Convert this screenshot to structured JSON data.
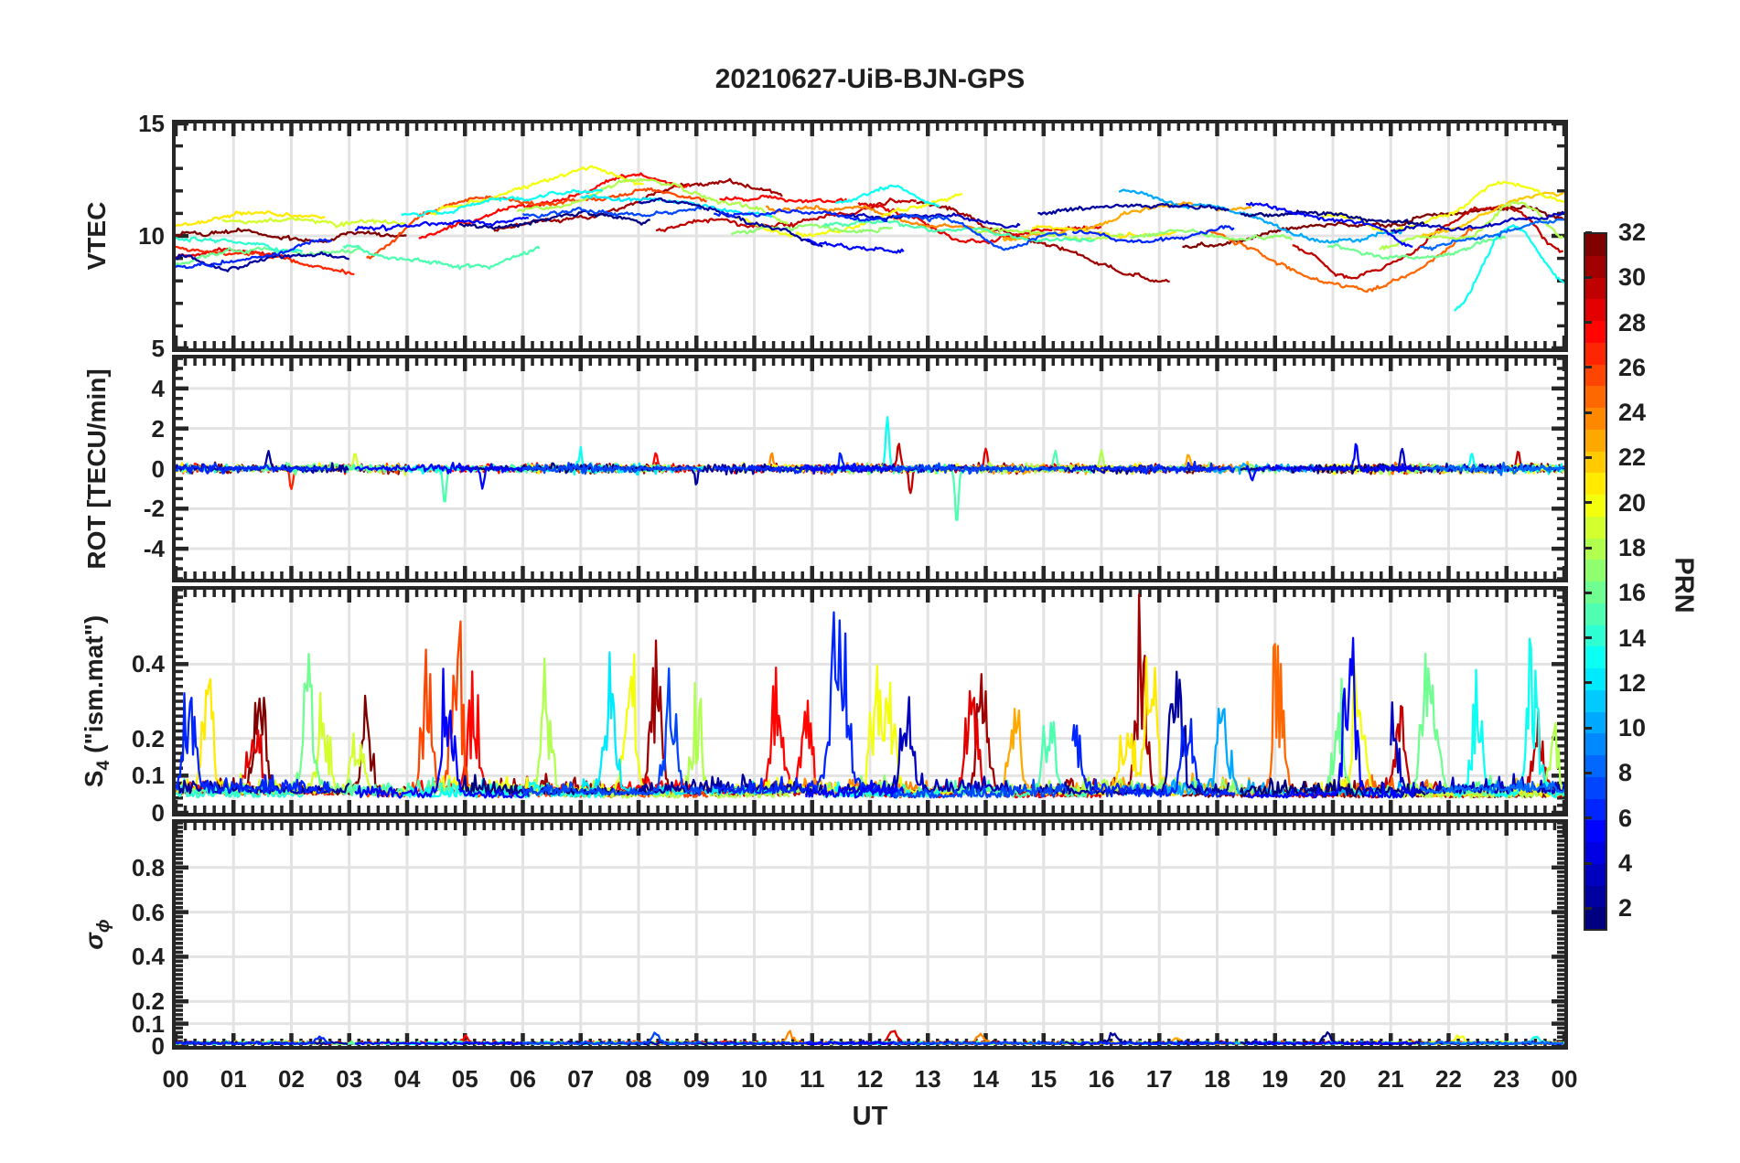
{
  "title": "20210627-UiB-BJN-GPS",
  "xlabel": "UT",
  "colorbar": {
    "label": "PRN",
    "min": 1,
    "max": 32,
    "ticks": [
      2,
      4,
      6,
      8,
      10,
      12,
      14,
      16,
      18,
      20,
      22,
      24,
      26,
      28,
      30,
      32
    ]
  },
  "style": {
    "axis": "#262626",
    "grid": "#e3e3e3",
    "text": "#1f1f1f",
    "bg": "#ffffff"
  },
  "chart_data": {
    "type": "line",
    "x": {
      "unit": "hours UT",
      "range": [
        0,
        24
      ],
      "tick_step": 1,
      "tick_labels": [
        "00",
        "01",
        "02",
        "03",
        "04",
        "05",
        "06",
        "07",
        "08",
        "09",
        "10",
        "11",
        "12",
        "13",
        "14",
        "15",
        "16",
        "17",
        "18",
        "19",
        "20",
        "21",
        "22",
        "23",
        "00"
      ]
    },
    "seed": 1234,
    "series_format": "[prn, t_start_h, t_end_h, [control values sampled evenly in time]]",
    "spike_format": "[t_hour, prn, peak_value]",
    "panels": [
      {
        "id": "vtec",
        "ylabel": "VTEC",
        "ylim": [
          5,
          15
        ],
        "yticks": [
          5,
          10,
          15
        ],
        "minor_step": 1,
        "series": [
          [
            32,
            0.0,
            4.0,
            [
              10.2,
              10.25,
              9.9,
              10.05,
              9.8
            ]
          ],
          [
            31,
            5.5,
            10.5,
            [
              10.3,
              10.7,
              11.15,
              12.0,
              12.55,
              11.8
            ]
          ],
          [
            30,
            8.3,
            12.8,
            [
              10.25,
              10.55,
              10.4,
              11.0,
              11.75
            ]
          ],
          [
            31,
            12.8,
            17.2,
            [
              11.5,
              10.9,
              10.25,
              9.35,
              8.55,
              7.9
            ]
          ],
          [
            32,
            17.4,
            24.0,
            [
              9.4,
              9.9,
              10.2,
              10.6,
              10.5,
              11.0,
              11.35,
              10.65
            ]
          ],
          [
            29,
            0.0,
            1.9,
            [
              9.0,
              9.35,
              9.2
            ]
          ],
          [
            28,
            4.2,
            8.9,
            [
              10.0,
              10.75,
              11.3,
              11.9,
              12.65,
              12.2
            ]
          ],
          [
            28,
            9.4,
            11.6,
            [
              11.6,
              11.5,
              11.45
            ]
          ],
          [
            29,
            11.8,
            16.0,
            [
              11.35,
              10.8,
              9.6,
              10.35,
              10.2
            ]
          ],
          [
            30,
            19.3,
            24.0,
            [
              9.6,
              8.0,
              9.0,
              10.6,
              11.3,
              9.4
            ]
          ],
          [
            27,
            0.0,
            3.1,
            [
              9.6,
              9.2,
              8.9,
              8.3
            ]
          ],
          [
            26,
            3.3,
            9.2,
            [
              9.1,
              10.8,
              11.9,
              11.3,
              11.8,
              12.0,
              11.5
            ]
          ],
          [
            25,
            17.8,
            22.5,
            [
              10.1,
              9.3,
              8.25,
              7.6,
              8.8,
              10.3
            ]
          ],
          [
            24,
            10.2,
            14.5,
            [
              11.3,
              11.2,
              10.85,
              10.4,
              10.0
            ]
          ],
          [
            23,
            14.3,
            18.6,
            [
              9.8,
              10.3,
              10.95,
              11.4,
              11.25
            ]
          ],
          [
            22,
            21.5,
            24.0,
            [
              9.9,
              10.7,
              11.6,
              11.8
            ]
          ],
          [
            21,
            0.0,
            2.6,
            [
              10.4,
              11.15,
              10.7
            ]
          ],
          [
            20,
            4.4,
            8.1,
            [
              10.9,
              11.6,
              12.3,
              12.85,
              12.4
            ]
          ],
          [
            20,
            9.7,
            13.6,
            [
              10.8,
              10.1,
              10.4,
              11.2,
              11.7
            ]
          ],
          [
            21,
            14.8,
            17.3,
            [
              10.4,
              10.05,
              10.3
            ]
          ],
          [
            20,
            19.8,
            24.0,
            [
              10.9,
              10.4,
              11.0,
              12.3,
              11.7
            ]
          ],
          [
            19,
            0.8,
            4.0,
            [
              10.6,
              11.0,
              10.4,
              10.7
            ]
          ],
          [
            18,
            5.9,
            10.6,
            [
              11.0,
              11.6,
              12.2,
              12.3,
              11.4,
              10.4
            ]
          ],
          [
            17,
            9.6,
            12.4,
            [
              10.2,
              10.5,
              10.15
            ]
          ],
          [
            18,
            13.8,
            16.4,
            [
              10.2,
              9.95,
              10.1
            ]
          ],
          [
            17,
            16.5,
            19.3,
            [
              10.0,
              9.9,
              9.8
            ]
          ],
          [
            18,
            20.8,
            24.0,
            [
              9.4,
              9.8,
              10.1,
              11.4,
              9.8
            ]
          ],
          [
            16,
            0.0,
            3.2,
            [
              8.6,
              9.4,
              9.0,
              9.3
            ]
          ],
          [
            15,
            2.9,
            6.3,
            [
              9.4,
              9.0,
              8.45,
              9.7
            ]
          ],
          [
            15,
            11.2,
            15.9,
            [
              10.4,
              10.6,
              10.3,
              9.9,
              9.8
            ]
          ],
          [
            16,
            19.9,
            23.0,
            [
              9.4,
              9.15,
              9.0,
              9.9
            ]
          ],
          [
            14,
            0.0,
            2.2,
            [
              9.9,
              9.7,
              9.5
            ]
          ],
          [
            13,
            3.9,
            7.4,
            [
              10.9,
              11.4,
              11.7,
              12.1
            ]
          ],
          [
            12,
            7.0,
            10.3,
            [
              11.8,
              11.5,
              11.2,
              10.9
            ]
          ],
          [
            13,
            11.4,
            13.2,
            [
              11.5,
              12.0,
              11.3
            ]
          ],
          [
            10,
            16.3,
            21.2,
            [
              11.9,
              11.6,
              11.0,
              10.2,
              9.7,
              10.3
            ]
          ],
          [
            13,
            22.1,
            24.0,
            [
              6.7,
              10.3,
              8.0
            ]
          ],
          [
            2,
            0.0,
            3.0,
            [
              9.0,
              8.8,
              9.1,
              9.0
            ]
          ],
          [
            1,
            4.9,
            8.2,
            [
              10.4,
              10.6,
              10.9,
              10.7
            ]
          ],
          [
            2,
            8.0,
            11.2,
            [
              11.6,
              11.3,
              10.6,
              9.5
            ]
          ],
          [
            3,
            11.5,
            14.6,
            [
              10.9,
              10.7,
              10.9,
              10.6
            ]
          ],
          [
            2,
            14.9,
            18.2,
            [
              10.9,
              11.3,
              11.4,
              11.2
            ]
          ],
          [
            1,
            18.4,
            21.6,
            [
              10.9,
              11.0,
              10.8,
              10.5
            ]
          ],
          [
            3,
            21.0,
            24.0,
            [
              10.3,
              10.4,
              10.8,
              10.9
            ]
          ],
          [
            6,
            0.0,
            2.7,
            [
              8.6,
              9.0,
              9.6
            ]
          ],
          [
            5,
            3.1,
            6.1,
            [
              10.3,
              10.5,
              10.4,
              10.6
            ]
          ],
          [
            7,
            6.0,
            9.1,
            [
              10.9,
              11.2,
              10.9,
              11.1
            ]
          ],
          [
            6,
            9.3,
            12.3,
            [
              10.9,
              11.0,
              10.8,
              10.7
            ]
          ],
          [
            5,
            10.9,
            12.6,
            [
              9.9,
              9.4,
              9.5
            ]
          ],
          [
            7,
            12.4,
            15.4,
            [
              10.9,
              10.5,
              9.6,
              9.9
            ]
          ],
          [
            6,
            15.5,
            18.3,
            [
              10.1,
              9.9,
              10.2
            ]
          ],
          [
            5,
            18.5,
            21.4,
            [
              11.3,
              11.1,
              10.6,
              9.7
            ]
          ],
          [
            8,
            21.5,
            24.0,
            [
              9.5,
              9.9,
              10.3,
              10.6
            ]
          ]
        ]
      },
      {
        "id": "rot",
        "ylabel": "ROT [TECU/min]",
        "ylim": [
          -5.5,
          5.5
        ],
        "yticks": [
          -4,
          -2,
          0,
          2,
          4
        ],
        "minor_step": 0.5,
        "baseline": 0,
        "noise_amp": 0.14,
        "spikes": [
          [
            1.6,
            2,
            0.9
          ],
          [
            2.0,
            26,
            -1.0
          ],
          [
            3.1,
            21,
            0.8
          ],
          [
            4.65,
            15,
            -1.7
          ],
          [
            5.3,
            5,
            -0.9
          ],
          [
            7.0,
            13,
            0.9
          ],
          [
            8.3,
            28,
            0.8
          ],
          [
            9.0,
            2,
            -0.8
          ],
          [
            10.3,
            24,
            0.7
          ],
          [
            11.5,
            7,
            0.8
          ],
          [
            12.3,
            13,
            2.5
          ],
          [
            12.5,
            31,
            1.3
          ],
          [
            12.7,
            31,
            -1.3
          ],
          [
            13.5,
            15,
            -2.7
          ],
          [
            14.0,
            29,
            1.0
          ],
          [
            15.2,
            15,
            0.8
          ],
          [
            16.0,
            16,
            0.9
          ],
          [
            17.5,
            24,
            0.8
          ],
          [
            18.6,
            5,
            -0.7
          ],
          [
            20.4,
            5,
            1.2
          ],
          [
            21.2,
            3,
            1.0
          ],
          [
            22.4,
            14,
            0.8
          ],
          [
            23.2,
            29,
            0.9
          ]
        ]
      },
      {
        "id": "s4",
        "ylabel": "S4 (\"ism.mat\")",
        "ylabel_parts": {
          "pre": "S",
          "sub": "4",
          "post": " (\"ism.mat\")",
          "italic": false
        },
        "ylim": [
          0,
          0.6
        ],
        "yticks": [
          0,
          0.1,
          0.2,
          0.4
        ],
        "minor_step": 0.02,
        "baseline": 0.05,
        "spikes": [
          [
            0.25,
            6,
            0.37
          ],
          [
            0.55,
            22,
            0.33
          ],
          [
            1.35,
            29,
            0.3
          ],
          [
            1.45,
            32,
            0.38
          ],
          [
            2.3,
            15,
            0.4
          ],
          [
            2.55,
            18,
            0.28
          ],
          [
            3.15,
            21,
            0.25
          ],
          [
            3.3,
            32,
            0.27
          ],
          [
            4.35,
            26,
            0.38
          ],
          [
            4.7,
            6,
            0.37
          ],
          [
            4.85,
            26,
            0.5
          ],
          [
            5.15,
            28,
            0.3
          ],
          [
            6.4,
            16,
            0.32
          ],
          [
            7.5,
            13,
            0.37
          ],
          [
            7.85,
            20,
            0.55
          ],
          [
            8.3,
            31,
            0.42
          ],
          [
            8.55,
            6,
            0.4
          ],
          [
            9.0,
            18,
            0.25
          ],
          [
            10.4,
            28,
            0.43
          ],
          [
            10.9,
            26,
            0.36
          ],
          [
            11.35,
            7,
            0.38
          ],
          [
            11.55,
            9,
            0.45
          ],
          [
            12.1,
            20,
            0.36
          ],
          [
            12.35,
            19,
            0.33
          ],
          [
            12.65,
            5,
            0.3
          ],
          [
            13.75,
            29,
            0.45
          ],
          [
            13.95,
            31,
            0.38
          ],
          [
            14.5,
            23,
            0.28
          ],
          [
            15.1,
            15,
            0.3
          ],
          [
            15.55,
            10,
            0.28
          ],
          [
            16.45,
            20,
            0.3
          ],
          [
            16.7,
            32,
            0.47
          ],
          [
            16.85,
            20,
            0.45
          ],
          [
            17.3,
            2,
            0.44
          ],
          [
            17.5,
            5,
            0.35
          ],
          [
            18.1,
            8,
            0.3
          ],
          [
            19.05,
            26,
            0.38
          ],
          [
            20.1,
            17,
            0.31
          ],
          [
            20.3,
            6,
            0.53
          ],
          [
            20.45,
            20,
            0.4
          ],
          [
            21.0,
            3,
            0.33
          ],
          [
            21.15,
            29,
            0.28
          ],
          [
            21.6,
            12,
            0.28
          ],
          [
            21.75,
            15,
            0.3
          ],
          [
            22.5,
            14,
            0.33
          ],
          [
            23.45,
            15,
            0.42
          ],
          [
            23.55,
            29,
            0.26
          ],
          [
            23.8,
            18,
            0.25
          ]
        ]
      },
      {
        "id": "sigma_phi",
        "ylabel": "σϕ",
        "ylabel_parts": {
          "pre": "σ",
          "sub": "ϕ",
          "post": "",
          "italic": true
        },
        "ylim": [
          0,
          1
        ],
        "yticks": [
          0,
          0.1,
          0.2,
          0.4,
          0.6,
          0.8
        ],
        "minor_step": 0.02,
        "baseline": 0.01,
        "spikes": [
          [
            2.5,
            10,
            0.045
          ],
          [
            5.0,
            28,
            0.04
          ],
          [
            8.3,
            5,
            0.05
          ],
          [
            10.6,
            24,
            0.05
          ],
          [
            12.4,
            29,
            0.09
          ],
          [
            13.9,
            24,
            0.05
          ],
          [
            16.2,
            2,
            0.05
          ],
          [
            17.3,
            26,
            0.04
          ],
          [
            19.9,
            3,
            0.05
          ],
          [
            22.2,
            20,
            0.045
          ],
          [
            23.5,
            15,
            0.04
          ]
        ]
      }
    ]
  }
}
